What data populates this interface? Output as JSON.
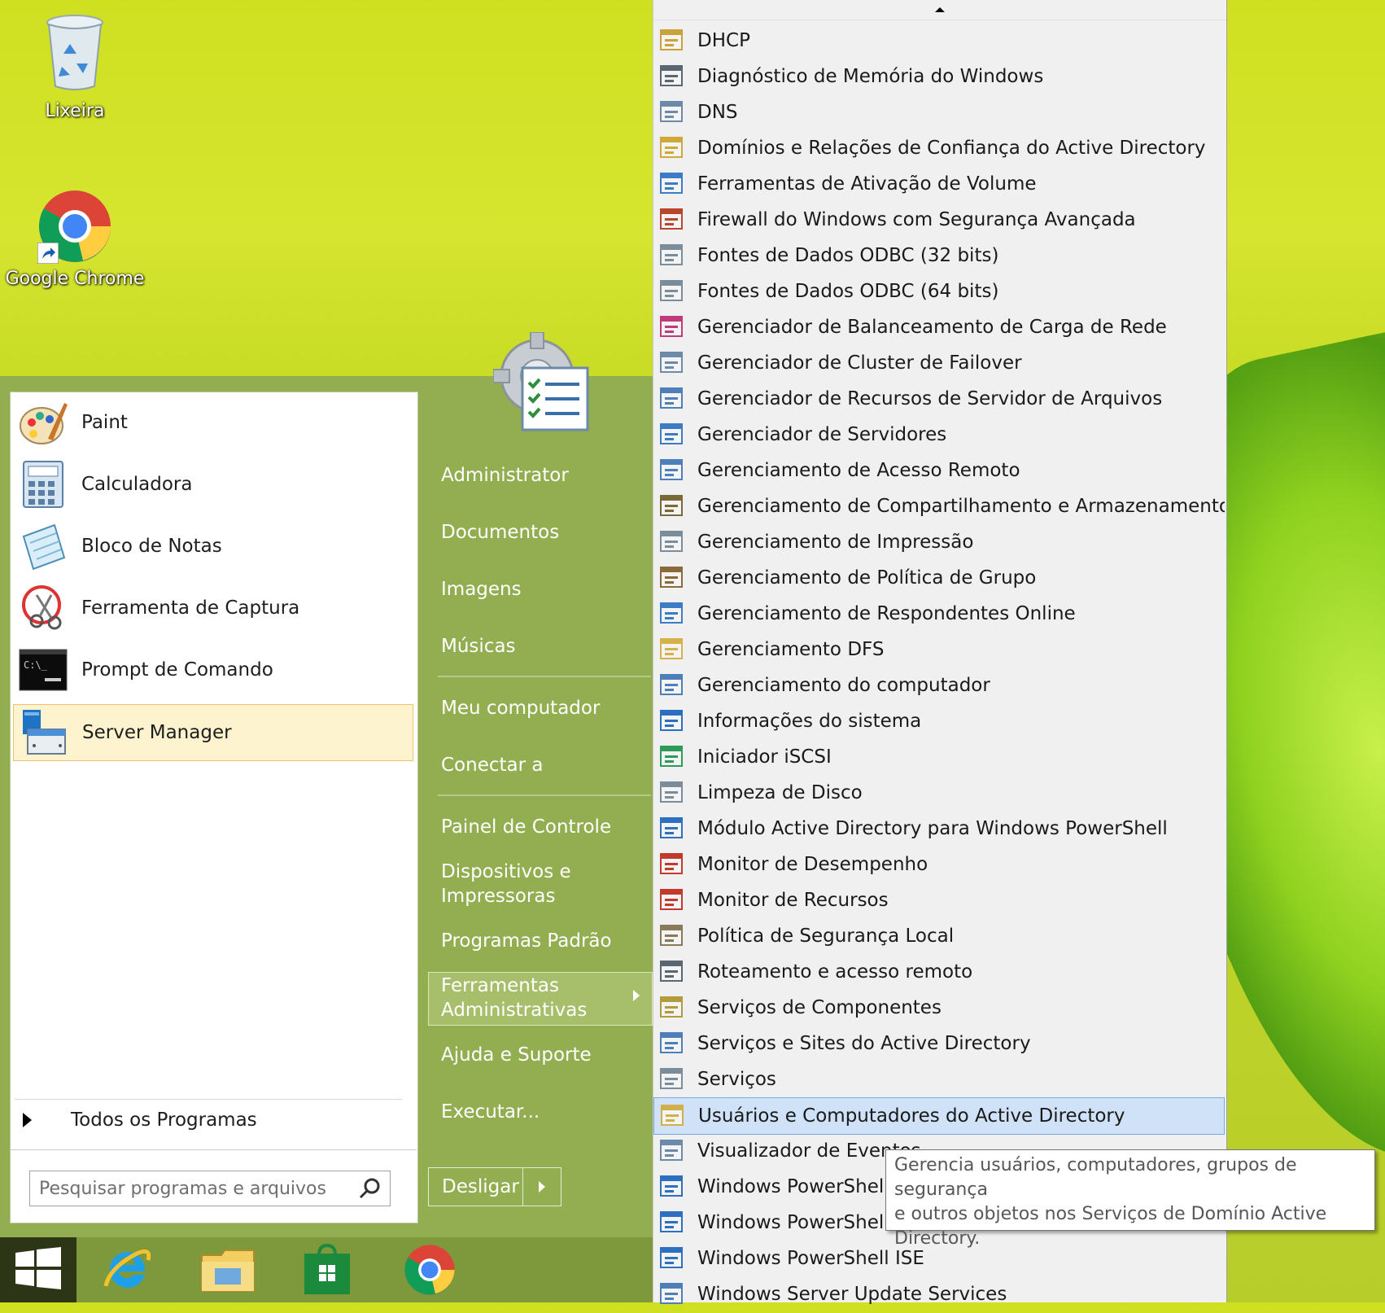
{
  "desktop": {
    "icons": [
      {
        "label": "Lixeira",
        "icon": "recycle-bin-icon"
      },
      {
        "label": "Google Chrome",
        "icon": "chrome-icon"
      }
    ]
  },
  "start_menu": {
    "pinned_programs": [
      {
        "label": "Paint",
        "icon": "paint-icon"
      },
      {
        "label": "Calculadora",
        "icon": "calculator-icon"
      },
      {
        "label": "Bloco de Notas",
        "icon": "notepad-icon"
      },
      {
        "label": "Ferramenta de Captura",
        "icon": "snipping-tool-icon"
      },
      {
        "label": "Prompt de Comando",
        "icon": "command-prompt-icon"
      },
      {
        "label": "Server Manager",
        "icon": "server-manager-icon",
        "selected": true
      }
    ],
    "all_programs_label": "Todos os Programas",
    "search_placeholder": "Pesquisar programas e arquivos",
    "right_links": {
      "user": "Administrator",
      "documents": "Documentos",
      "images": "Imagens",
      "music": "Músicas",
      "computer": "Meu computador",
      "connect": "Conectar a",
      "control_panel": "Painel de Controle",
      "devices_line1": "Dispositivos e",
      "devices_line2": "Impressoras",
      "default_programs": "Programas Padrão",
      "admin_tools_line1": "Ferramentas",
      "admin_tools_line2": "Administrativas",
      "help": "Ajuda e Suporte",
      "run": "Executar..."
    },
    "shutdown_label": "Desligar"
  },
  "admin_tools_menu": {
    "items": [
      "DHCP",
      "Diagnóstico de Memória do Windows",
      "DNS",
      "Domínios e Relações de Confiança do Active Directory",
      "Ferramentas de Ativação de Volume",
      "Firewall do Windows com Segurança Avançada",
      "Fontes de Dados ODBC (32 bits)",
      "Fontes de Dados ODBC (64 bits)",
      "Gerenciador de Balanceamento de Carga de Rede",
      "Gerenciador de Cluster de Failover",
      "Gerenciador de Recursos de Servidor de Arquivos",
      "Gerenciador de Servidores",
      "Gerenciamento de Acesso Remoto",
      "Gerenciamento de Compartilhamento e Armazenamento",
      "Gerenciamento de Impressão",
      "Gerenciamento de Política de Grupo",
      "Gerenciamento de Respondentes Online",
      "Gerenciamento DFS",
      "Gerenciamento do computador",
      "Informações do sistema",
      "Iniciador iSCSI",
      "Limpeza de Disco",
      "Módulo Active Directory para Windows PowerShell",
      "Monitor de Desempenho",
      "Monitor de Recursos",
      "Política de Segurança Local",
      "Roteamento e acesso remoto",
      "Serviços de Componentes",
      "Serviços e Sites do Active Directory",
      "Serviços",
      "Usuários e Computadores do Active Directory",
      "Visualizador de Eventos",
      "Windows PowerShell (",
      "Windows PowerShell I",
      "Windows PowerShell ISE",
      "Windows Server Update Services"
    ],
    "highlighted_index": 30
  },
  "tooltip": {
    "line1": "Gerencia usuários, computadores, grupos de segurança",
    "line2": "e outros objetos nos Serviços de Domínio Active",
    "line3": "Directory."
  },
  "taskbar": {
    "items": [
      "start-button",
      "internet-explorer-icon",
      "file-explorer-icon",
      "store-icon",
      "chrome-icon"
    ]
  }
}
